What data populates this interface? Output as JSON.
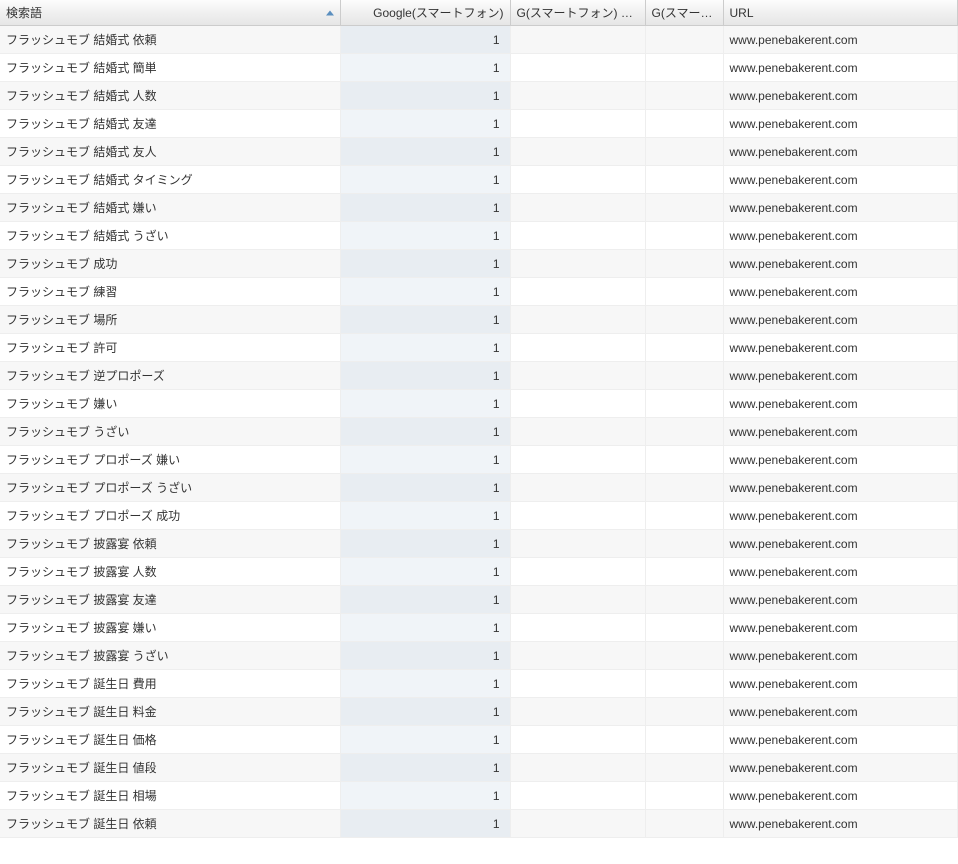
{
  "table": {
    "headers": {
      "keyword": "検索語",
      "google_sp": "Google(スマートフォン)",
      "g_sp_change": "G(スマートフォン) 変化",
      "g_sp_short": "G(スマートフ..",
      "url": "URL"
    },
    "rows": [
      {
        "keyword": "フラッシュモブ 結婚式 依頼",
        "google_sp": "1",
        "change": "",
        "g3": "",
        "url": "www.penebakerent.com"
      },
      {
        "keyword": "フラッシュモブ 結婚式 簡単",
        "google_sp": "1",
        "change": "",
        "g3": "",
        "url": "www.penebakerent.com"
      },
      {
        "keyword": "フラッシュモブ 結婚式 人数",
        "google_sp": "1",
        "change": "",
        "g3": "",
        "url": "www.penebakerent.com"
      },
      {
        "keyword": "フラッシュモブ 結婚式 友達",
        "google_sp": "1",
        "change": "",
        "g3": "",
        "url": "www.penebakerent.com"
      },
      {
        "keyword": "フラッシュモブ 結婚式 友人",
        "google_sp": "1",
        "change": "",
        "g3": "",
        "url": "www.penebakerent.com"
      },
      {
        "keyword": "フラッシュモブ 結婚式 タイミング",
        "google_sp": "1",
        "change": "",
        "g3": "",
        "url": "www.penebakerent.com"
      },
      {
        "keyword": "フラッシュモブ 結婚式 嫌い",
        "google_sp": "1",
        "change": "",
        "g3": "",
        "url": "www.penebakerent.com"
      },
      {
        "keyword": "フラッシュモブ 結婚式 うざい",
        "google_sp": "1",
        "change": "",
        "g3": "",
        "url": "www.penebakerent.com"
      },
      {
        "keyword": "フラッシュモブ 成功",
        "google_sp": "1",
        "change": "",
        "g3": "",
        "url": "www.penebakerent.com"
      },
      {
        "keyword": "フラッシュモブ 練習",
        "google_sp": "1",
        "change": "",
        "g3": "",
        "url": "www.penebakerent.com"
      },
      {
        "keyword": "フラッシュモブ 場所",
        "google_sp": "1",
        "change": "",
        "g3": "",
        "url": "www.penebakerent.com"
      },
      {
        "keyword": "フラッシュモブ 許可",
        "google_sp": "1",
        "change": "",
        "g3": "",
        "url": "www.penebakerent.com"
      },
      {
        "keyword": "フラッシュモブ 逆プロポーズ",
        "google_sp": "1",
        "change": "",
        "g3": "",
        "url": "www.penebakerent.com"
      },
      {
        "keyword": "フラッシュモブ 嫌い",
        "google_sp": "1",
        "change": "",
        "g3": "",
        "url": "www.penebakerent.com"
      },
      {
        "keyword": "フラッシュモブ うざい",
        "google_sp": "1",
        "change": "",
        "g3": "",
        "url": "www.penebakerent.com"
      },
      {
        "keyword": "フラッシュモブ プロポーズ 嫌い",
        "google_sp": "1",
        "change": "",
        "g3": "",
        "url": "www.penebakerent.com"
      },
      {
        "keyword": "フラッシュモブ プロポーズ うざい",
        "google_sp": "1",
        "change": "",
        "g3": "",
        "url": "www.penebakerent.com"
      },
      {
        "keyword": "フラッシュモブ プロポーズ 成功",
        "google_sp": "1",
        "change": "",
        "g3": "",
        "url": "www.penebakerent.com"
      },
      {
        "keyword": "フラッシュモブ 披露宴 依頼",
        "google_sp": "1",
        "change": "",
        "g3": "",
        "url": "www.penebakerent.com"
      },
      {
        "keyword": "フラッシュモブ 披露宴 人数",
        "google_sp": "1",
        "change": "",
        "g3": "",
        "url": "www.penebakerent.com"
      },
      {
        "keyword": "フラッシュモブ 披露宴 友達",
        "google_sp": "1",
        "change": "",
        "g3": "",
        "url": "www.penebakerent.com"
      },
      {
        "keyword": "フラッシュモブ 披露宴 嫌い",
        "google_sp": "1",
        "change": "",
        "g3": "",
        "url": "www.penebakerent.com"
      },
      {
        "keyword": "フラッシュモブ 披露宴 うざい",
        "google_sp": "1",
        "change": "",
        "g3": "",
        "url": "www.penebakerent.com"
      },
      {
        "keyword": "フラッシュモブ 誕生日 費用",
        "google_sp": "1",
        "change": "",
        "g3": "",
        "url": "www.penebakerent.com"
      },
      {
        "keyword": "フラッシュモブ 誕生日 料金",
        "google_sp": "1",
        "change": "",
        "g3": "",
        "url": "www.penebakerent.com"
      },
      {
        "keyword": "フラッシュモブ 誕生日 価格",
        "google_sp": "1",
        "change": "",
        "g3": "",
        "url": "www.penebakerent.com"
      },
      {
        "keyword": "フラッシュモブ 誕生日 値段",
        "google_sp": "1",
        "change": "",
        "g3": "",
        "url": "www.penebakerent.com"
      },
      {
        "keyword": "フラッシュモブ 誕生日 相場",
        "google_sp": "1",
        "change": "",
        "g3": "",
        "url": "www.penebakerent.com"
      },
      {
        "keyword": "フラッシュモブ 誕生日 依頼",
        "google_sp": "1",
        "change": "",
        "g3": "",
        "url": "www.penebakerent.com"
      }
    ]
  }
}
